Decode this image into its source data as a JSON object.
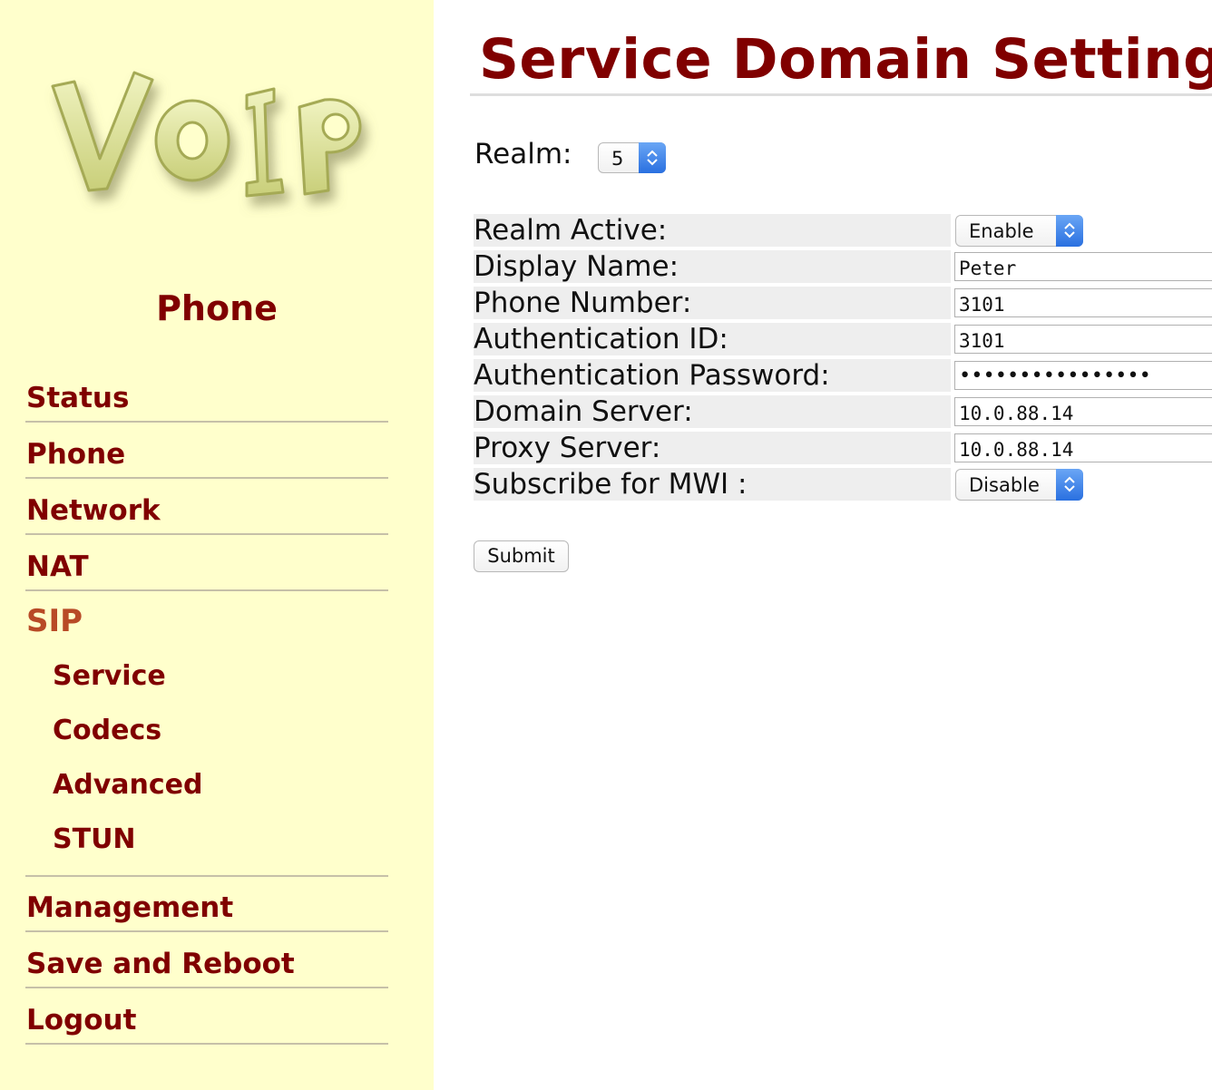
{
  "sidebar": {
    "logo_text": "VoIP",
    "title": "Phone",
    "items": [
      {
        "label": "Status"
      },
      {
        "label": "Phone"
      },
      {
        "label": "Network"
      },
      {
        "label": "NAT"
      },
      {
        "label": "SIP",
        "active": true
      },
      {
        "label": "Management"
      },
      {
        "label": "Save and Reboot"
      },
      {
        "label": "Logout"
      }
    ],
    "sip_subitems": [
      {
        "label": "Service"
      },
      {
        "label": "Codecs"
      },
      {
        "label": "Advanced"
      },
      {
        "label": "STUN"
      }
    ]
  },
  "main": {
    "title": "Service Domain Setting",
    "realm_label": "Realm:",
    "realm_value": "5",
    "form": {
      "realm_active": {
        "label": "Realm Active:",
        "value": "Enable"
      },
      "display_name": {
        "label": "Display Name:",
        "value": "Peter"
      },
      "phone_number": {
        "label": "Phone Number:",
        "value": "3101"
      },
      "auth_id": {
        "label": "Authentication ID:",
        "value": "3101"
      },
      "auth_password": {
        "label": "Authentication Password:",
        "value": "••••••••••••••••"
      },
      "domain_server": {
        "label": "Domain Server:",
        "value": "10.0.88.14"
      },
      "proxy_server": {
        "label": "Proxy Server:",
        "value": "10.0.88.14"
      },
      "subscribe_mwi": {
        "label": "Subscribe for MWI :",
        "value": "Disable"
      }
    },
    "submit_label": "Submit"
  },
  "colors": {
    "sidebar_bg": "#ffffcc",
    "brand_red": "#800000",
    "active_nav": "#b84a26",
    "select_accent": "#2a70e0"
  },
  "icons": [
    "voip-logo",
    "updown-chevron-icon"
  ]
}
